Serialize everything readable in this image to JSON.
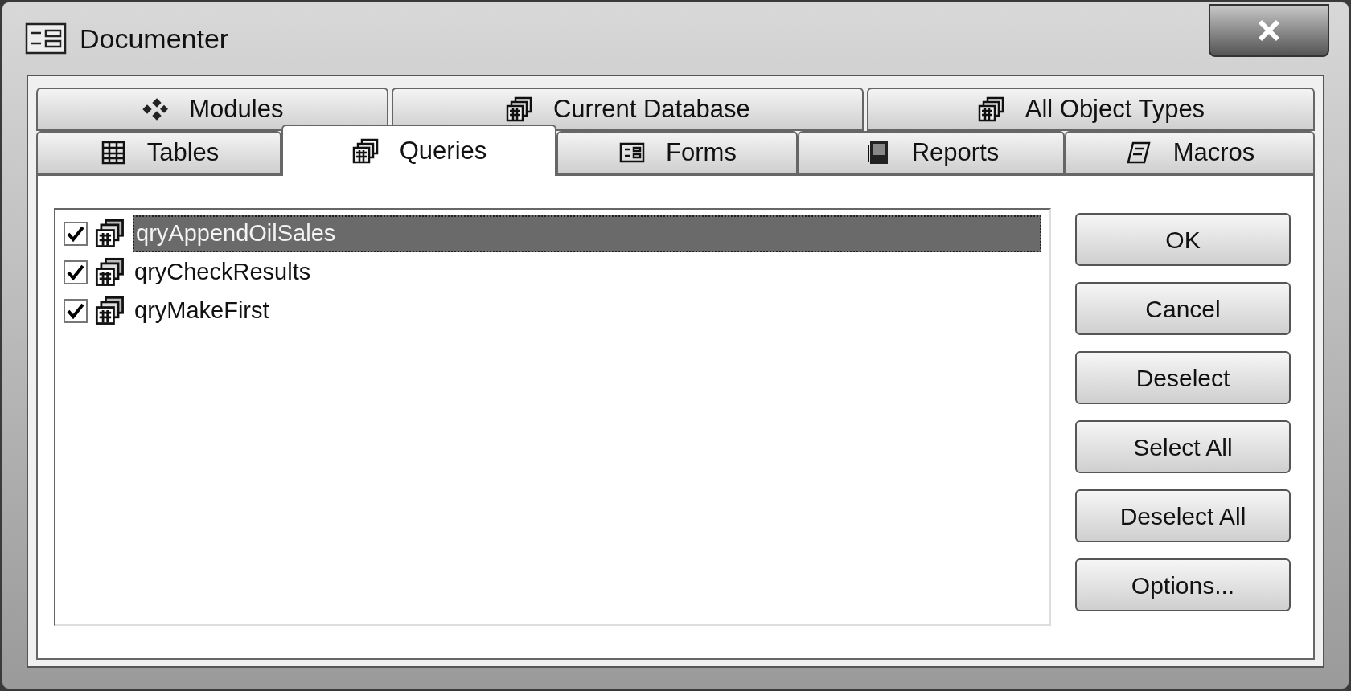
{
  "window": {
    "title": "Documenter"
  },
  "tab_rows": [
    [
      {
        "label": "Modules",
        "selected": false
      },
      {
        "label": "Current Database",
        "selected": false
      },
      {
        "label": "All Object Types",
        "selected": false
      }
    ],
    [
      {
        "label": "Tables",
        "selected": false
      },
      {
        "label": "Queries",
        "selected": true
      },
      {
        "label": "Forms",
        "selected": false
      },
      {
        "label": "Reports",
        "selected": false
      },
      {
        "label": "Macros",
        "selected": false
      }
    ]
  ],
  "items": [
    {
      "name": "qryAppendOilSales",
      "checked": true,
      "selected": true
    },
    {
      "name": "qryCheckResults",
      "checked": true,
      "selected": false
    },
    {
      "name": "qryMakeFirst",
      "checked": true,
      "selected": false
    }
  ],
  "buttons": [
    "OK",
    "Cancel",
    "Deselect",
    "Select All",
    "Deselect All",
    "Options..."
  ]
}
